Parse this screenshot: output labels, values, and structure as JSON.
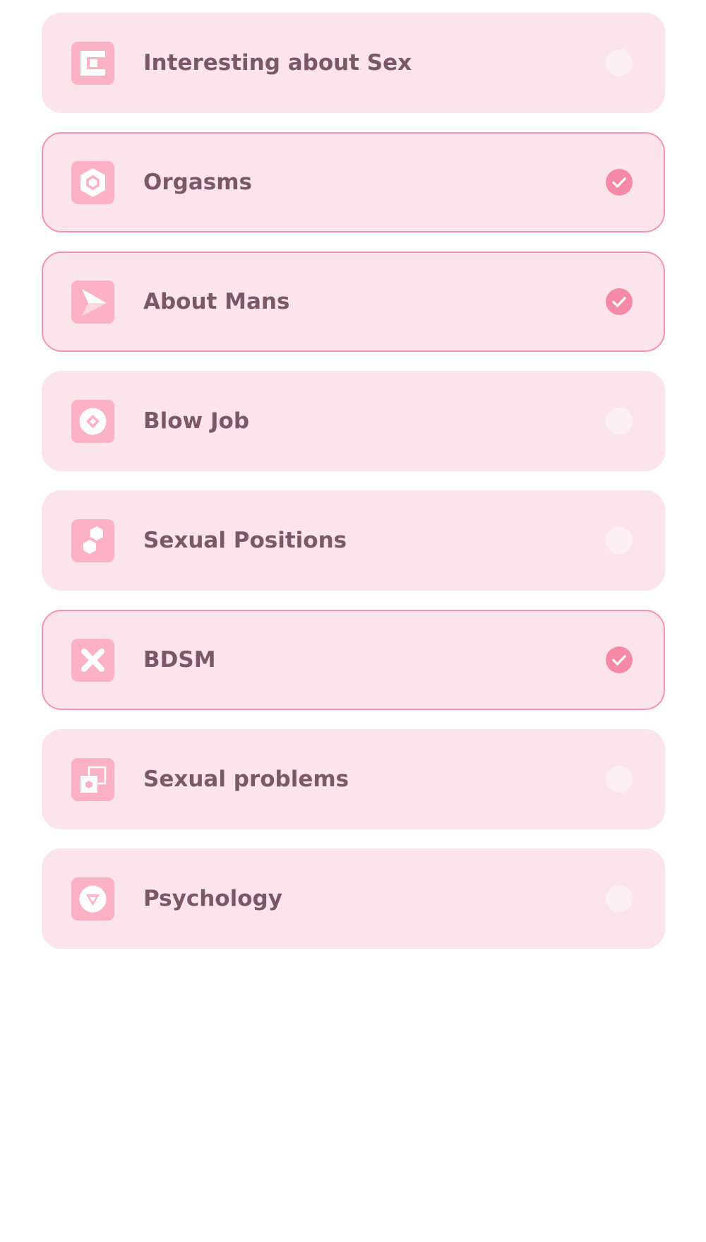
{
  "topics": [
    {
      "label": "Interesting about Sex",
      "icon": "bracket-square-icon",
      "selected": false
    },
    {
      "label": "Orgasms",
      "icon": "hexagon-icon",
      "selected": true
    },
    {
      "label": "About Mans",
      "icon": "play-arrow-icon",
      "selected": true
    },
    {
      "label": "Blow Job",
      "icon": "circle-diamond-icon",
      "selected": false
    },
    {
      "label": "Sexual Positions",
      "icon": "double-hexagon-icon",
      "selected": false
    },
    {
      "label": "BDSM",
      "icon": "cross-icon",
      "selected": true
    },
    {
      "label": "Sexual problems",
      "icon": "overlapping-squares-icon",
      "selected": false
    },
    {
      "label": "Psychology",
      "icon": "circle-triangle-icon",
      "selected": false
    }
  ],
  "colors": {
    "card_background": "#fce4ed",
    "selected_border": "#f595ad",
    "icon_tile": "#fdb1c4",
    "label_text": "#7a5866",
    "check_selected": "#f58aa6",
    "check_unselected": "#fdf0f4"
  }
}
